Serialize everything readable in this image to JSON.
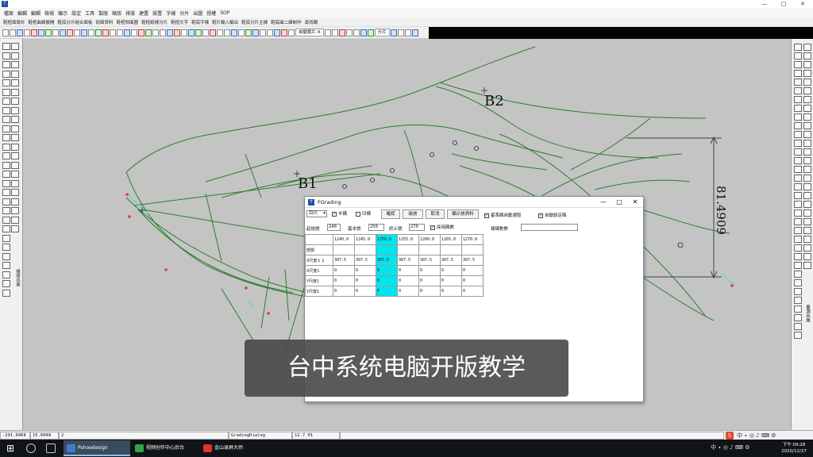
{
  "window": {
    "title_logo": "T",
    "controls": [
      "—",
      "□",
      "✕"
    ]
  },
  "menu": [
    "檔案",
    "編輯",
    "編輯",
    "檢視",
    "顯示",
    "設定",
    "工具",
    "製版",
    "縮放",
    "排版",
    "建置",
    "設置",
    "字樣",
    "分片",
    "出圖",
    "授權",
    "SOP"
  ],
  "command_bar": [
    "鞋楦面設計",
    "鞋楦曲線展開",
    "鞋底分片組合面板",
    "剖面資料",
    "鞋楦斜面圖",
    "鞋楦紙樣分片",
    "鞋楦文字",
    "鞋底字樣",
    "鞋片輸入輸出",
    "鞋底分片主線",
    "鞋底曲二維制作",
    "尋找網"
  ],
  "toolbar": {
    "label_a": "自動裁片 A",
    "label_b": "分片"
  },
  "left_panel_label": "樣版出面",
  "right_panel_label": "量測出面",
  "canvas": {
    "labels": {
      "b1": "B1",
      "b2": "B2",
      "dimension": "81.4909"
    },
    "colors": {
      "background": "#c4c4c4",
      "line": "#2d7d2d",
      "accent": "#58d6e0",
      "point": "#d43f3f"
    }
  },
  "dialog": {
    "title": "FGrading",
    "mode_select": "目尺",
    "checkbox_half": "半碼",
    "checkbox_half_checked": true,
    "checkbox_repeat": "印標",
    "checkbox_repeat_checked": false,
    "btn_confirm": "確認",
    "btn_grade": "級放",
    "btn_cancel": "取消",
    "btn_show": "顯示放資料",
    "checkbox_base": "基準碼自動選取",
    "checkbox_base_checked": true,
    "checkbox_auto": "自動設定碼",
    "checkbox_auto_checked": true,
    "start_label": "起始號",
    "start_value": "240",
    "base_label": "基本號",
    "base_value": "250",
    "end_label": "終止號",
    "end_value": "270",
    "checkbox_mode": "採用碼數",
    "checkbox_mode_checked": true,
    "size_count_label": "樣碼數數",
    "size_count_value": "",
    "table": {
      "headers": [
        "",
        "1240.0",
        "1245.0",
        "1250.0",
        "1255.0",
        "1260.0",
        "1265.0",
        "1270.0"
      ],
      "highlight_col": 3,
      "rows": [
        [
          "部部",
          "",
          "",
          "",
          "",
          "",
          "",
          ""
        ],
        [
          "X尺度↕ 1",
          "307.5",
          "307.5",
          "307.5",
          "307.5",
          "307.5",
          "307.5",
          "307.5"
        ],
        [
          "X尺度1",
          "0",
          "0",
          "0",
          "0",
          "0",
          "0",
          "0"
        ],
        [
          "Y尺度1",
          "0",
          "0",
          "0",
          "0",
          "0",
          "0",
          "0"
        ],
        [
          "Y尺度1",
          "0",
          "0",
          "0",
          "0",
          "0",
          "0",
          "0"
        ]
      ]
    }
  },
  "banner_text": "台中系统电脑开版教学",
  "status": {
    "coords": "-291.0468",
    "coords2": "15.6048",
    "field3": "2",
    "message": "GradingDialog",
    "scale": "12.7 01"
  },
  "taskbar": {
    "tasks": [
      {
        "label": "Pshoedesign",
        "active": true,
        "color": "#3a7bd5"
      },
      {
        "label": "视频创作中心后台",
        "active": false,
        "color": "#2ea64a"
      },
      {
        "label": "金山录屏大师",
        "active": false,
        "color": "#d33"
      }
    ],
    "tray": "中 ∙ ◎ ♪ ⌨ ⚙",
    "time": "下午 09:28",
    "date": "2020/12/27"
  }
}
